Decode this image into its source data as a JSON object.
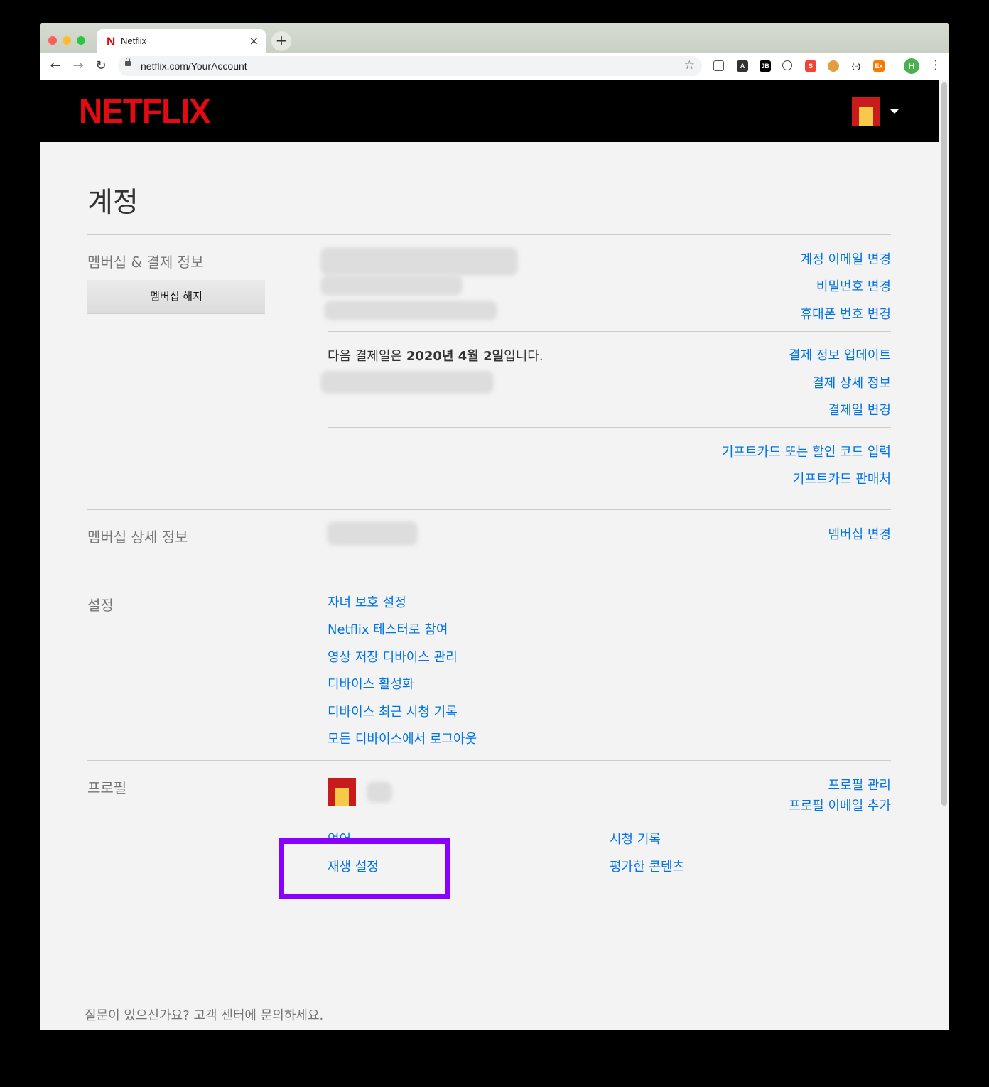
{
  "browser": {
    "tab_title": "Netflix",
    "tab_favicon": "N",
    "url": "netflix.com/YourAccount",
    "profile_initial": "H"
  },
  "header": {
    "logo": "NETFLIX"
  },
  "page": {
    "title": "계정"
  },
  "membership": {
    "section_label": "멤버십 & 결제 정보",
    "cancel_button": "멤버십 해지",
    "links": [
      "계정 이메일 변경",
      "비밀번호 변경",
      "휴대폰 번호 변경"
    ],
    "billing_prefix": "다음 결제일은 ",
    "billing_date": "2020년 4월 2일",
    "billing_suffix": "입니다.",
    "billing_links": [
      "결제 정보 업데이트",
      "결제 상세 정보",
      "결제일 변경"
    ],
    "gift_links": [
      "기프트카드 또는 할인 코드 입력",
      "기프트카드 판매처"
    ]
  },
  "plan": {
    "section_label": "멤버십 상세 정보",
    "change_link": "멤버십 변경"
  },
  "settings": {
    "section_label": "설정",
    "links": [
      "자녀 보호 설정",
      "Netflix 테스터로 참여",
      "영상 저장 디바이스 관리",
      "디바이스 활성화",
      "디바이스 최근 시청 기록",
      "모든 디바이스에서 로그아웃"
    ]
  },
  "profile": {
    "section_label": "프로필",
    "manage_link": "프로필 관리",
    "add_email_link": "프로필 이메일 추가",
    "language_link": "언어",
    "playback_link": "재생 설정",
    "viewing_link": "시청 기록",
    "ratings_link": "평가한 콘텐츠"
  },
  "footer": {
    "question": "질문이 있으신가요? 고객 센터에 문의하세요."
  }
}
